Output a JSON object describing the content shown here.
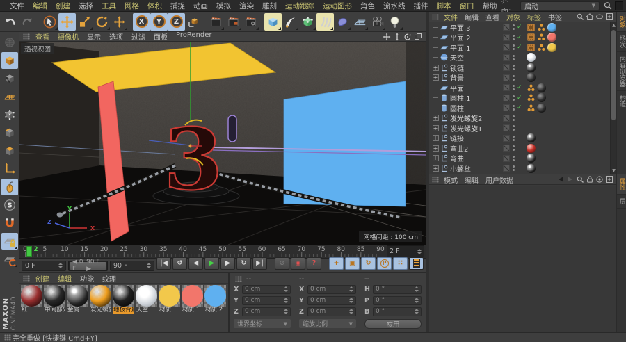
{
  "app": {
    "interface_label": "界面:",
    "interface_value": "启动"
  },
  "menubar": {
    "items": [
      {
        "label": "文件",
        "hl": false
      },
      {
        "label": "编辑",
        "hl": true
      },
      {
        "label": "创建",
        "hl": true
      },
      {
        "label": "选择",
        "hl": false
      },
      {
        "label": "工具",
        "hl": true
      },
      {
        "label": "网格",
        "hl": true
      },
      {
        "label": "体积",
        "hl": true
      },
      {
        "label": "捕捉",
        "hl": false
      },
      {
        "label": "动画",
        "hl": false
      },
      {
        "label": "模拟",
        "hl": false
      },
      {
        "label": "渲染",
        "hl": false
      },
      {
        "label": "雕刻",
        "hl": false
      },
      {
        "label": "运动跟踪",
        "hl": true
      },
      {
        "label": "运动图形",
        "hl": true
      },
      {
        "label": "角色",
        "hl": false
      },
      {
        "label": "流水线",
        "hl": false
      },
      {
        "label": "插件",
        "hl": false
      },
      {
        "label": "脚本",
        "hl": true
      },
      {
        "label": "窗口",
        "hl": true
      },
      {
        "label": "帮助",
        "hl": false
      }
    ]
  },
  "toolbar": {
    "buttons": [
      {
        "name": "undo"
      },
      {
        "name": "redo",
        "disabled": true
      },
      {
        "sep": true
      },
      {
        "name": "live-selection",
        "sub": true
      },
      {
        "name": "move",
        "active": true
      },
      {
        "name": "scale",
        "sub": true
      },
      {
        "name": "rotate",
        "sub": true
      },
      {
        "name": "last-tool",
        "sub": true
      },
      {
        "sep": true
      },
      {
        "name": "lock-x",
        "label": "X",
        "active": true
      },
      {
        "name": "lock-y",
        "label": "Y",
        "active": true
      },
      {
        "name": "lock-z",
        "label": "Z",
        "active": true
      },
      {
        "name": "coord-system"
      },
      {
        "sep": true
      },
      {
        "name": "render-view",
        "sub": true
      },
      {
        "name": "render-picture-viewer",
        "sub": true
      },
      {
        "name": "render-settings",
        "sub": true
      },
      {
        "sep": true
      },
      {
        "name": "primitive-cube",
        "active_y": true,
        "sub": true
      },
      {
        "name": "spline-pen",
        "sub": true
      },
      {
        "name": "subdivision-surface",
        "sub": true
      },
      {
        "name": "sweep",
        "active_y": true,
        "sub": true
      },
      {
        "name": "deformer",
        "sub": true
      },
      {
        "name": "floor",
        "sub": true
      },
      {
        "name": "camera",
        "sub": true
      },
      {
        "name": "light",
        "sub": true
      }
    ]
  },
  "left_toolbar": {
    "buttons": [
      {
        "name": "make-editable",
        "disabled": true
      },
      {
        "name": "model-mode",
        "active": true
      },
      {
        "name": "texture-mode"
      },
      {
        "name": "workplane-mode"
      },
      {
        "name": "points-mode"
      },
      {
        "name": "edges-mode"
      },
      {
        "name": "polygons-mode"
      },
      {
        "name": "axis-mode"
      },
      {
        "name": "tweak-mode",
        "active": true
      },
      {
        "name": "snap"
      },
      {
        "name": "magnet"
      },
      {
        "name": "lock-workplane",
        "active": true,
        "sub": true
      },
      {
        "name": "workplane",
        "sub": true
      }
    ],
    "logo_top": "MAXON",
    "logo_bottom": "CINEMA4D"
  },
  "viewport": {
    "menu": [
      {
        "label": "查看",
        "hl": true
      },
      {
        "label": "摄像机",
        "hl": true
      },
      {
        "label": "显示",
        "hl": false
      },
      {
        "label": "选项",
        "hl": false
      },
      {
        "label": "过滤",
        "hl": false
      },
      {
        "label": "面板",
        "hl": false
      },
      {
        "label": "ProRender",
        "hl": false
      }
    ],
    "corner_icons": [
      "pan",
      "dolly",
      "orbit",
      "toggle-views"
    ],
    "view_label": "透视视图",
    "grid_label": "网格间距 : 100 cm",
    "number": "3",
    "axis": {
      "x": "X",
      "y": "Y",
      "z": "Z"
    }
  },
  "timeline": {
    "labels": [
      0,
      5,
      10,
      15,
      20,
      25,
      30,
      35,
      40,
      45,
      50,
      55,
      60,
      65,
      70,
      75,
      80,
      85,
      90
    ],
    "current": "2",
    "current_frame": 2,
    "frame_field": "2 F"
  },
  "playback": {
    "start_field": "0 F",
    "end_field": "90 F",
    "range_start": "0 F",
    "range_end": "90 F",
    "transport": [
      {
        "name": "goto-start"
      },
      {
        "name": "play-reverse"
      },
      {
        "name": "prev-frame"
      },
      {
        "name": "play",
        "green": true
      },
      {
        "name": "next-frame"
      },
      {
        "name": "play-loop"
      },
      {
        "name": "goto-end"
      }
    ],
    "record": [
      {
        "name": "record-off",
        "style": "dim"
      },
      {
        "name": "record-key",
        "style": "red"
      },
      {
        "name": "autokey-question",
        "style": "red"
      }
    ],
    "key_toggles": [
      {
        "name": "key-position"
      },
      {
        "name": "key-scale"
      },
      {
        "name": "key-rotation"
      },
      {
        "name": "key-parameter"
      },
      {
        "name": "key-pla"
      }
    ],
    "timeline_button": {
      "name": "open-timeline"
    }
  },
  "materials": {
    "menu": [
      {
        "label": "创建",
        "hl": true
      },
      {
        "label": "编辑",
        "hl": true
      },
      {
        "label": "功能",
        "hl": false
      },
      {
        "label": "纹理",
        "hl": false
      }
    ],
    "items": [
      {
        "label": "红",
        "thumb": "ball:#9a2f2f"
      },
      {
        "label": "中间部分",
        "thumb": "ball:#2a2a2a"
      },
      {
        "label": "金属",
        "thumb": "chrome"
      },
      {
        "label": "发光螺旋",
        "thumb": "ball:#f09f1f"
      },
      {
        "label": "地板背景",
        "thumb": "ball:#202020",
        "selected": true
      },
      {
        "label": "天空",
        "thumb": "sky"
      },
      {
        "label": "材质",
        "thumb": "flat:#f2c84b"
      },
      {
        "label": "材质.1",
        "thumb": "flat:#f2766b"
      },
      {
        "label": "材质.2",
        "thumb": "flat:#5fb0f0"
      }
    ]
  },
  "coordinates": {
    "columns": [
      {
        "header": "--",
        "rows": [
          [
            "X",
            "0 cm"
          ],
          [
            "Y",
            "0 cm"
          ],
          [
            "Z",
            "0 cm"
          ]
        ],
        "footer": "世界坐标",
        "footer_type": "dropdown"
      },
      {
        "header": "--",
        "rows": [
          [
            "X",
            "0 cm"
          ],
          [
            "Y",
            "0 cm"
          ],
          [
            "Z",
            "0 cm"
          ]
        ],
        "footer": "缩放比例",
        "footer_type": "dropdown"
      },
      {
        "header": "--",
        "rows": [
          [
            "H",
            "0 °"
          ],
          [
            "P",
            "0 °"
          ],
          [
            "B",
            "0 °"
          ]
        ],
        "footer": "应用",
        "footer_type": "button"
      }
    ]
  },
  "object_manager": {
    "menu": [
      {
        "label": "文件",
        "hl": true
      },
      {
        "label": "编辑",
        "hl": false
      },
      {
        "label": "查看",
        "hl": false
      },
      {
        "label": "对象",
        "hl": true
      },
      {
        "label": "标签",
        "hl": true
      },
      {
        "label": "书签",
        "hl": false
      }
    ],
    "side_tabs": [
      {
        "label": "对象",
        "active": true
      },
      {
        "label": "场次",
        "active": false
      },
      {
        "label": "内容浏览器",
        "active": false
      },
      {
        "label": "构造",
        "active": false
      }
    ],
    "objects": [
      {
        "name": "平面.3",
        "icon": "plane",
        "enabled": true,
        "expand": false,
        "tags": [
          "texture",
          "phong",
          "mat:flat:#5fb0f0"
        ]
      },
      {
        "name": "平面.2",
        "icon": "plane",
        "enabled": true,
        "expand": false,
        "tags": [
          "texture",
          "phong",
          "mat:flat:#f2766b"
        ]
      },
      {
        "name": "平面.1",
        "icon": "plane",
        "enabled": true,
        "expand": false,
        "tags": [
          "texture",
          "phong",
          "mat:flat:#f2c84b"
        ]
      },
      {
        "name": "天空",
        "icon": "sky",
        "enabled": false,
        "expand": false,
        "tags": [
          "mat:sky"
        ]
      },
      {
        "name": "锁链",
        "icon": "null",
        "enabled": false,
        "expand": true,
        "tags": [
          "mat:chrome"
        ]
      },
      {
        "name": "背景",
        "icon": "null",
        "enabled": false,
        "expand": true,
        "tags": [
          "mat:dark"
        ]
      },
      {
        "name": "平面",
        "icon": "plane",
        "enabled": true,
        "expand": false,
        "tags": [
          "phong",
          "mat:dark"
        ]
      },
      {
        "name": "圆柱.1",
        "icon": "cylinder",
        "enabled": true,
        "expand": false,
        "tags": [
          "phong",
          "mat:dark"
        ]
      },
      {
        "name": "圆柱",
        "icon": "cylinder",
        "enabled": true,
        "expand": false,
        "tags": [
          "phong",
          "mat:dark"
        ]
      },
      {
        "name": "发光螺旋2",
        "icon": "null",
        "enabled": false,
        "expand": true,
        "tags": []
      },
      {
        "name": "发光螺旋1",
        "icon": "null",
        "enabled": false,
        "expand": true,
        "tags": []
      },
      {
        "name": "链接",
        "icon": "null",
        "enabled": false,
        "expand": true,
        "tags": [
          "mat:chrome"
        ]
      },
      {
        "name": "弯曲2",
        "icon": "null",
        "enabled": false,
        "expand": true,
        "tags": [
          "mat:red"
        ]
      },
      {
        "name": "弯曲",
        "icon": "null",
        "enabled": false,
        "expand": true,
        "tags": [
          "mat:chrome"
        ]
      },
      {
        "name": "小螺丝",
        "icon": "null",
        "enabled": false,
        "expand": true,
        "tags": [
          "mat:chrome"
        ]
      }
    ]
  },
  "attribute_manager": {
    "menu": [
      {
        "label": "模式",
        "hl": false
      },
      {
        "label": "编辑",
        "hl": false
      },
      {
        "label": "用户数据",
        "hl": false
      }
    ],
    "side_tabs": [
      {
        "label": "属性",
        "active": true
      },
      {
        "label": "层",
        "active": false
      }
    ]
  },
  "status_bar": {
    "text": "完全重做 [快捷键 Cmd+Y]"
  }
}
